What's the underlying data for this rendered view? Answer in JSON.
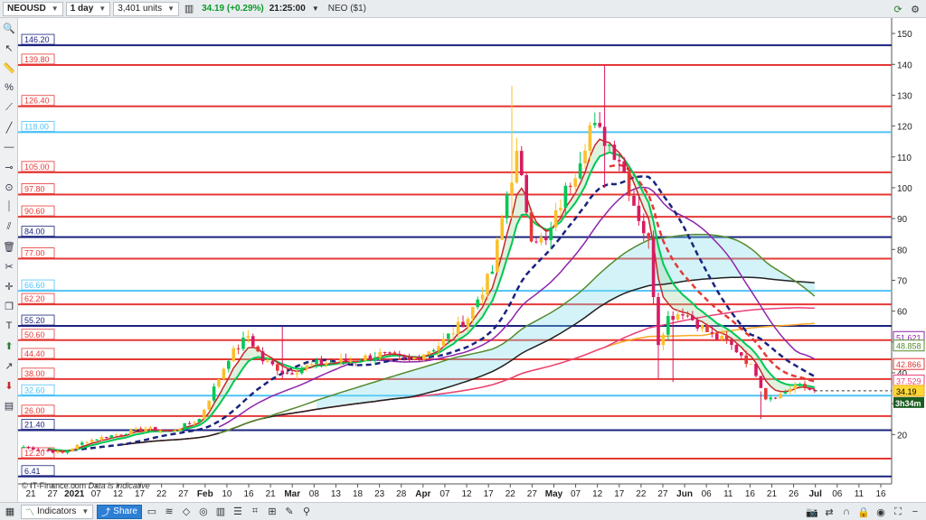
{
  "toolbar": {
    "symbol": "NEOUSD",
    "timeframe": "1 day",
    "units": "3,401 units",
    "price": "34.19",
    "change": "(+0.29%)",
    "time": "21:25:00",
    "asset_name": "NEO ($1)"
  },
  "bottombar": {
    "indicators_label": "Indicators",
    "share_label": "Share"
  },
  "watermark": {
    "source": "© IT-Finance.com",
    "note": "Data is indicative"
  },
  "colors": {
    "navy": "#1a237e",
    "red": "#e53935",
    "lightblue": "#4fc3f7",
    "bull": "#2e7d32",
    "bear": "#c62828"
  },
  "chart_data": {
    "type": "candlestick",
    "ylim": [
      4,
      155
    ],
    "y_ticks": [
      20,
      30,
      40,
      50,
      60,
      70,
      80,
      90,
      100,
      110,
      120,
      130,
      140,
      150
    ],
    "x_ticks": [
      "21",
      "27",
      "2021",
      "07",
      "12",
      "17",
      "22",
      "27",
      "Feb",
      "10",
      "16",
      "21",
      "Mar",
      "08",
      "13",
      "18",
      "23",
      "28",
      "Apr",
      "07",
      "12",
      "17",
      "22",
      "27",
      "May",
      "07",
      "12",
      "17",
      "22",
      "27",
      "Jun",
      "06",
      "11",
      "16",
      "21",
      "26",
      "Jul",
      "06",
      "11",
      "16"
    ],
    "horizontal_levels": [
      {
        "value": 146.2,
        "label": "146.20",
        "color": "navy"
      },
      {
        "value": 139.8,
        "label": "139.80",
        "color": "red"
      },
      {
        "value": 126.4,
        "label": "126.40",
        "color": "red"
      },
      {
        "value": 118.0,
        "label": "118.00",
        "color": "lightblue"
      },
      {
        "value": 105.0,
        "label": "105.00",
        "color": "red"
      },
      {
        "value": 97.8,
        "label": "97.80",
        "color": "red"
      },
      {
        "value": 90.6,
        "label": "90.60",
        "color": "red"
      },
      {
        "value": 84.0,
        "label": "84.00",
        "color": "navy"
      },
      {
        "value": 77.0,
        "label": "77.00",
        "color": "red"
      },
      {
        "value": 66.6,
        "label": "66.60",
        "color": "lightblue"
      },
      {
        "value": 62.2,
        "label": "62.20",
        "color": "red"
      },
      {
        "value": 55.2,
        "label": "55.20",
        "color": "navy"
      },
      {
        "value": 50.6,
        "label": "50.60",
        "color": "red"
      },
      {
        "value": 44.4,
        "label": "44.40",
        "color": "red"
      },
      {
        "value": 38.0,
        "label": "38.00",
        "color": "red"
      },
      {
        "value": 32.6,
        "label": "32.60",
        "color": "lightblue"
      },
      {
        "value": 26.0,
        "label": "26.00",
        "color": "red"
      },
      {
        "value": 21.4,
        "label": "21.40",
        "color": "navy"
      },
      {
        "value": 12.2,
        "label": "12.20",
        "color": "red"
      },
      {
        "value": 6.41,
        "label": "6.41",
        "color": "navy"
      }
    ],
    "right_labels": [
      {
        "value": 51.621,
        "label": "51.621",
        "color": "#8e24aa"
      },
      {
        "value": 48.858,
        "label": "48.858",
        "color": "#558b2f"
      },
      {
        "value": 42.866,
        "label": "42.866",
        "color": "#e53935"
      },
      {
        "value": 37.529,
        "label": "37.529",
        "color": "#ec407a"
      },
      {
        "value": 34.19,
        "label": "34.19",
        "color": "#f9a825"
      }
    ],
    "countdown": "3h34m",
    "anchors": [
      [
        0,
        16
      ],
      [
        8,
        14
      ],
      [
        13,
        18
      ],
      [
        19,
        20
      ],
      [
        25,
        22
      ],
      [
        30,
        21
      ],
      [
        36,
        25
      ],
      [
        42,
        45
      ],
      [
        46,
        52
      ],
      [
        49,
        44
      ],
      [
        54,
        40
      ],
      [
        60,
        43
      ],
      [
        67,
        44
      ],
      [
        73,
        46
      ],
      [
        79,
        44
      ],
      [
        85,
        49
      ],
      [
        91,
        58
      ],
      [
        96,
        73
      ],
      [
        99,
        98
      ],
      [
        101,
        110
      ],
      [
        104,
        85
      ],
      [
        107,
        82
      ],
      [
        110,
        95
      ],
      [
        113,
        106
      ],
      [
        116,
        120
      ],
      [
        119,
        116
      ],
      [
        122,
        110
      ],
      [
        125,
        95
      ],
      [
        128,
        82
      ],
      [
        130,
        50
      ],
      [
        132,
        58
      ],
      [
        135,
        60
      ],
      [
        138,
        56
      ],
      [
        141,
        52
      ],
      [
        144,
        50
      ],
      [
        147,
        46
      ],
      [
        150,
        40
      ],
      [
        152,
        32
      ],
      [
        155,
        33
      ],
      [
        158,
        36
      ],
      [
        162,
        34.19
      ]
    ],
    "spikes": [
      {
        "i": 53,
        "high": 55,
        "low": 38
      },
      {
        "i": 100,
        "high": 133,
        "low": 90
      },
      {
        "i": 119,
        "high": 140,
        "low": 100
      },
      {
        "i": 130,
        "high": 66,
        "low": 38
      },
      {
        "i": 133,
        "high": 60,
        "low": 37
      },
      {
        "i": 151,
        "high": 34,
        "low": 25
      }
    ]
  }
}
